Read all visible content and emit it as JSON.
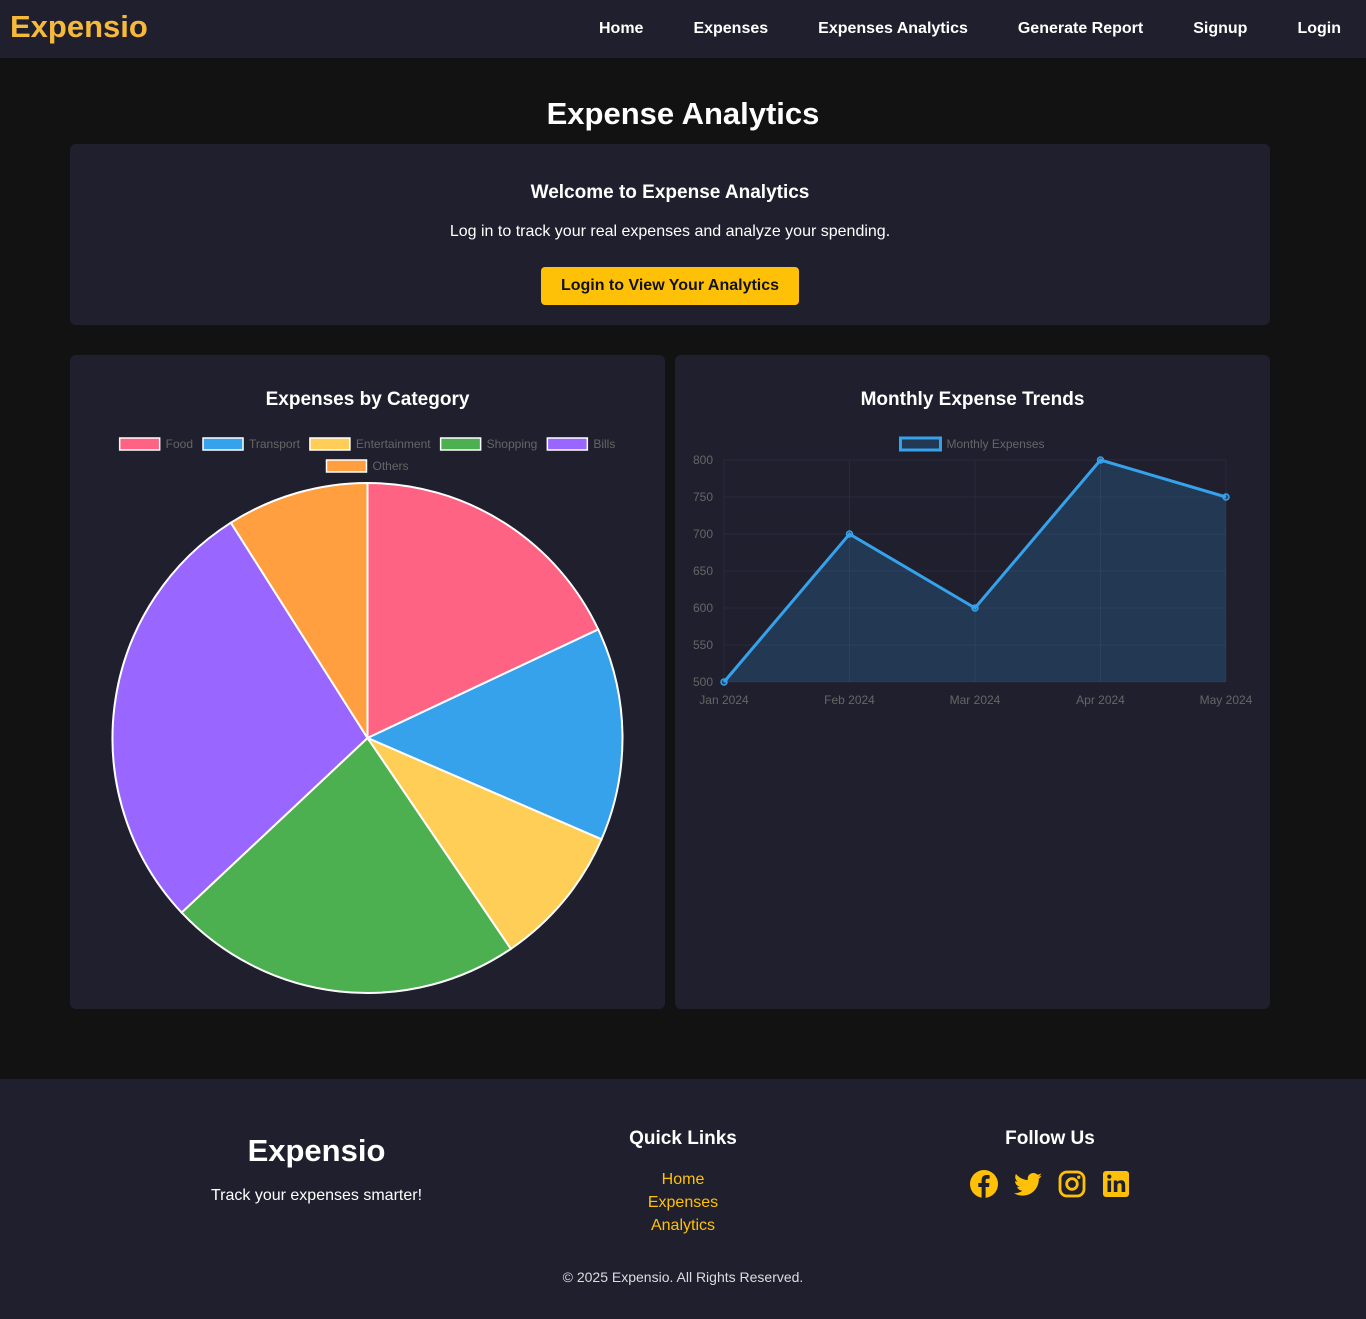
{
  "nav": {
    "brand": "Expensio",
    "links": [
      "Home",
      "Expenses",
      "Expenses Analytics",
      "Generate Report",
      "Signup",
      "Login"
    ]
  },
  "page": {
    "title": "Expense Analytics"
  },
  "welcome": {
    "title": "Welcome to Expense Analytics",
    "text": "Log in to track your real expenses and analyze your spending.",
    "button": "Login to View Your Analytics"
  },
  "chart_data": [
    {
      "type": "pie",
      "title": "Expenses by Category",
      "categories": [
        "Food",
        "Transport",
        "Entertainment",
        "Shopping",
        "Bills",
        "Others"
      ],
      "values": [
        18,
        13.5,
        9,
        22.5,
        28,
        9
      ],
      "colors": [
        "#ff6384",
        "#36a2eb",
        "#ffce56",
        "#4caf50",
        "#9966ff",
        "#ff9f40"
      ],
      "legend": "top"
    },
    {
      "type": "area",
      "title": "Monthly Expense Trends",
      "categories": [
        "Jan 2024",
        "Feb 2024",
        "Mar 2024",
        "Apr 2024",
        "May 2024"
      ],
      "series": [
        {
          "name": "Monthly Expenses",
          "values": [
            500,
            700,
            600,
            800,
            750
          ]
        }
      ],
      "ylim": [
        500,
        800
      ],
      "yticks": [
        800,
        750,
        700,
        650,
        600,
        550,
        500
      ],
      "color": "#36a2eb",
      "grid": true,
      "legend": "top"
    }
  ],
  "footer": {
    "brand": "Expensio",
    "tagline": "Track your expenses smarter!",
    "quick_links_title": "Quick Links",
    "quick_links": [
      "Home",
      "Expenses",
      "Analytics"
    ],
    "follow_title": "Follow Us",
    "social_icons": [
      "facebook-icon",
      "twitter-icon",
      "instagram-icon",
      "linkedin-icon"
    ],
    "copyright": "© 2025 Expensio. All Rights Reserved."
  },
  "colors": {
    "accent": "#ffc107",
    "brand": "#f6b93b",
    "panel": "#1f1f2e",
    "background": "#121212"
  }
}
